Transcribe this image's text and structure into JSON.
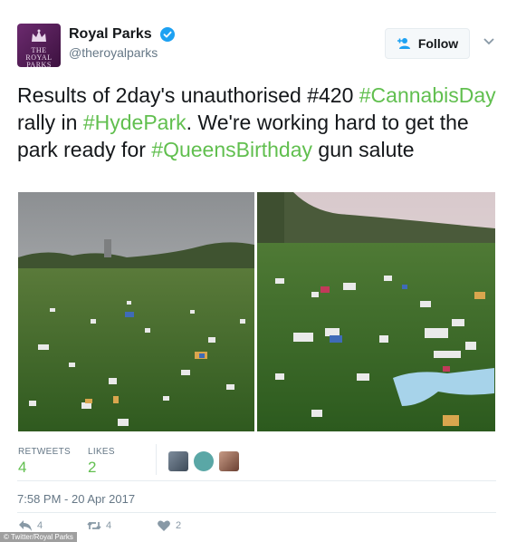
{
  "account": {
    "name": "Royal Parks",
    "handle": "@theroyalparks",
    "avatar_text": "THE ROYAL PARKS",
    "verified": true
  },
  "follow_button": {
    "label": "Follow"
  },
  "tweet": {
    "segments": [
      {
        "text": "Results of 2day's unauthorised #420 ",
        "type": "text"
      },
      {
        "text": "#CannabisDay",
        "type": "hashtag"
      },
      {
        "text": " rally in ",
        "type": "text"
      },
      {
        "text": "#HydePark",
        "type": "hashtag"
      },
      {
        "text": ". We're working hard to get the park ready for ",
        "type": "text"
      },
      {
        "text": "#QueensBirthday",
        "type": "hashtag"
      },
      {
        "text": " gun salute",
        "type": "text"
      }
    ]
  },
  "stats": {
    "retweets_label": "RETWEETS",
    "retweets": "4",
    "likes_label": "LIKES",
    "likes": "2"
  },
  "timestamp": "7:58 PM - 20 Apr 2017",
  "actions": {
    "reply_count": "4",
    "retweet_count": "4",
    "like_count": "2"
  },
  "credit": "© Twitter/Royal Parks",
  "colors": {
    "hashtag": "#61bf4f",
    "text": "#14171a",
    "muted": "#657786",
    "verified": "#1da1f2"
  },
  "icons": {
    "verified": "verified-badge-icon",
    "follow": "add-user-icon",
    "menu": "chevron-down-icon",
    "reply": "reply-icon",
    "retweet": "retweet-icon",
    "like": "heart-icon"
  }
}
